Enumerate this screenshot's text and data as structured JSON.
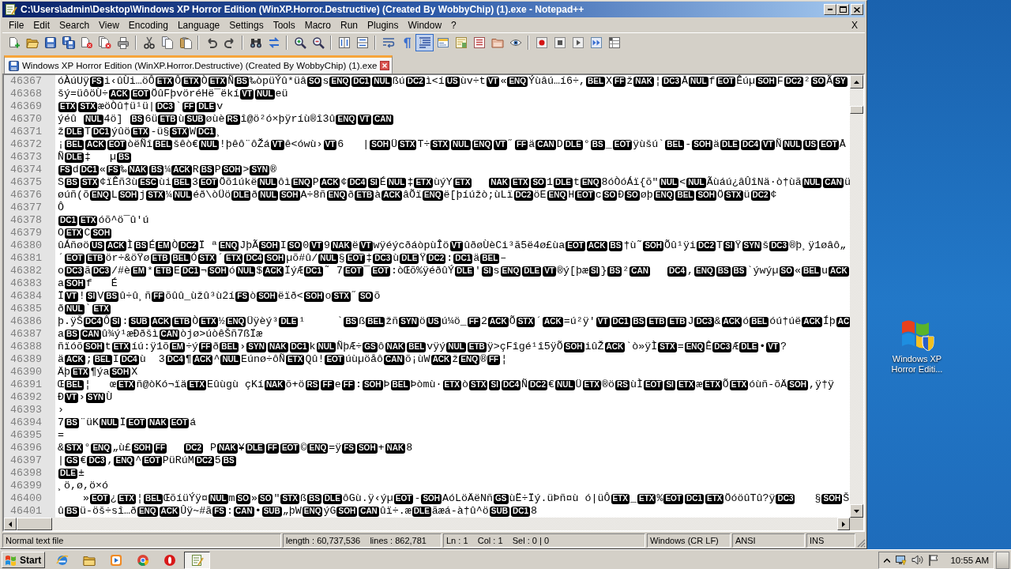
{
  "window": {
    "title": "C:\\Users\\admin\\Desktop\\Windows XP Horror Edition (WinXP.Horror.Destructive) (Created By WobbyChip) (1).exe - Notepad++"
  },
  "menu": {
    "items": [
      "File",
      "Edit",
      "Search",
      "View",
      "Encoding",
      "Language",
      "Settings",
      "Tools",
      "Macro",
      "Run",
      "Plugins",
      "Window",
      "?"
    ],
    "close": "X"
  },
  "toolbar": [
    {
      "buttons": [
        {
          "kind": "new",
          "pressed": false
        },
        {
          "kind": "open",
          "pressed": false
        },
        {
          "kind": "save",
          "pressed": false
        },
        {
          "kind": "save_all",
          "pressed": false
        },
        {
          "kind": "close",
          "pressed": false
        },
        {
          "kind": "close_all",
          "pressed": false
        },
        {
          "kind": "print",
          "pressed": false
        }
      ]
    },
    {
      "buttons": [
        {
          "kind": "cut",
          "pressed": false
        },
        {
          "kind": "copy",
          "pressed": false
        },
        {
          "kind": "paste",
          "pressed": false
        }
      ]
    },
    {
      "buttons": [
        {
          "kind": "undo",
          "pressed": false
        },
        {
          "kind": "redo",
          "pressed": false
        }
      ]
    },
    {
      "buttons": [
        {
          "kind": "find",
          "pressed": false
        },
        {
          "kind": "replace",
          "pressed": false
        }
      ]
    },
    {
      "buttons": [
        {
          "kind": "zoom_in",
          "pressed": false
        },
        {
          "kind": "zoom_out",
          "pressed": false
        }
      ]
    },
    {
      "buttons": [
        {
          "kind": "sync_vertical",
          "pressed": false
        },
        {
          "kind": "sync_horizontal",
          "pressed": false
        }
      ]
    },
    {
      "buttons": [
        {
          "kind": "word_wrap",
          "pressed": false
        },
        {
          "kind": "show_all",
          "pressed": false
        },
        {
          "kind": "indent_guide",
          "pressed": true
        },
        {
          "kind": "language",
          "pressed": false
        },
        {
          "kind": "doc_map",
          "pressed": false
        },
        {
          "kind": "function_list",
          "pressed": false
        },
        {
          "kind": "folder_workspace",
          "pressed": false
        },
        {
          "kind": "monitoring",
          "pressed": false
        }
      ]
    },
    {
      "buttons": [
        {
          "kind": "record",
          "pressed": false
        },
        {
          "kind": "stop",
          "pressed": false
        },
        {
          "kind": "play",
          "pressed": false
        },
        {
          "kind": "play_multiple",
          "pressed": false
        },
        {
          "kind": "save_macro",
          "pressed": false
        }
      ]
    }
  ],
  "tabs": [
    {
      "label": "Windows XP Horror Edition (WinXP.Horror.Destructive) (Created By WobbyChip) (1).exe",
      "selected": true
    }
  ],
  "editor": {
    "lines": [
      {
        "number": "46367",
        "runs": [
          {
            "text": "óÀúUÿ",
            "control": "FS"
          },
          {
            "text": "i‹ûÙi…öÔ",
            "control": "ETX"
          },
          {
            "text": "Ô",
            "control": "ETX"
          },
          {
            "text": "Ò",
            "control": "ETX"
          },
          {
            "text": "Ñ",
            "control": "BS"
          },
          {
            "text": "‰òpüÝû*üâ",
            "control": "SO"
          },
          {
            "text": "s",
            "control": "ENQ"
          },
          {
            "control": "DC1"
          },
          {
            "control": "NUL"
          },
          {
            "text": "ßú",
            "control": "DC2"
          },
          {
            "text": "ì<í",
            "control": "US"
          },
          {
            "text": "ùv÷t",
            "control": "VT"
          },
          {
            "text": "«",
            "control": "ENQ"
          },
          {
            "text": "Ýùâú…í6÷,",
            "control": "BEL"
          },
          {
            "text": "X",
            "control": "FF"
          },
          {
            "text": "ž",
            "control": "NAK"
          },
          {
            "text": "¦",
            "control": "DC3"
          },
          {
            "text": "Å",
            "control": "NUL"
          },
          {
            "text": "f",
            "control": "EOT"
          },
          {
            "text": "Êúµ",
            "control": "SOH"
          },
          {
            "text": "F",
            "control": "DC2"
          },
          {
            "text": "²",
            "control": "SO"
          },
          {
            "text": "Ã",
            "control": "SY"
          }
        ]
      },
      {
        "number": "46368",
        "runs": [
          {
            "text": "šý=üôöÙ÷",
            "control": "ACK"
          },
          {
            "control": "EOT"
          },
          {
            "text": "ÖûFþvöréHë¯ëkí",
            "control": "VT"
          },
          {
            "control": "NUL"
          },
          {
            "text": "eü"
          }
        ]
      },
      {
        "number": "46369",
        "runs": [
          {
            "control": "ETX"
          },
          {
            "control": "STX"
          },
          {
            "text": "æöÒû†ü¹ü|",
            "control": "DC3"
          },
          {
            "text": "`",
            "control": "FF"
          },
          {
            "control": "DLE"
          },
          {
            "text": "v"
          }
        ]
      },
      {
        "number": "46370",
        "runs": [
          {
            "text": "ýéû ",
            "control": "NUL"
          },
          {
            "text": "4ö] ",
            "control": "BS"
          },
          {
            "text": "6ü",
            "control": "ETB"
          },
          {
            "text": "ù",
            "control": "SUB"
          },
          {
            "text": "øùè",
            "control": "RS"
          },
          {
            "text": "î@ö²ó×þÿríù®î3û",
            "control": "ENQ"
          },
          {
            "control": "VT"
          },
          {
            "control": "CAN"
          }
        ]
      },
      {
        "number": "46371",
        "runs": [
          {
            "text": "ž",
            "control": "DLE"
          },
          {
            "text": "T",
            "control": "DC1"
          },
          {
            "text": "ýûö",
            "control": "ETX"
          },
          {
            "text": "-ü§",
            "control": "STX"
          },
          {
            "text": "W",
            "control": "DC1"
          },
          {
            "text": "¸"
          }
        ]
      },
      {
        "number": "46372",
        "runs": [
          {
            "text": "¡",
            "control": "BEL"
          },
          {
            "control": "ACK"
          },
          {
            "control": "EOT"
          },
          {
            "text": "òëÑî",
            "control": "BEL"
          },
          {
            "text": "šêò€",
            "control": "NUL"
          },
          {
            "text": "!þêô¨ôŽá",
            "control": "VT"
          },
          {
            "text": "ê<ówù›",
            "control": "VT"
          },
          {
            "text": "6   |",
            "control": "SOH"
          },
          {
            "text": "Ü",
            "control": "STX"
          },
          {
            "text": "T÷",
            "control": "STX"
          },
          {
            "control": "NUL"
          },
          {
            "control": "ENQ"
          },
          {
            "control": "VT"
          },
          {
            "text": "˝",
            "control": "FF"
          },
          {
            "text": "ä",
            "control": "CAN"
          },
          {
            "text": "D",
            "control": "DLE"
          },
          {
            "text": "°",
            "control": "BS"
          },
          {
            "text": "_",
            "control": "EOT"
          },
          {
            "text": "ÿùšú`",
            "control": "BEL"
          },
          {
            "text": "-",
            "control": "SOH"
          },
          {
            "text": "ä",
            "control": "DLE"
          },
          {
            "control": "DC4"
          },
          {
            "control": "VT"
          },
          {
            "text": "Ñ",
            "control": "NUL"
          },
          {
            "control": "US"
          },
          {
            "control": "EOT"
          },
          {
            "text": "Å"
          }
        ]
      },
      {
        "number": "46373",
        "runs": [
          {
            "text": "Ñ",
            "control": "DLE"
          },
          {
            "text": "‡   µ",
            "control": "BS"
          }
        ]
      },
      {
        "number": "46374",
        "runs": [
          {
            "control": "FS"
          },
          {
            "text": "d",
            "control": "DC1"
          },
          {
            "text": "«",
            "control": "FS"
          },
          {
            "text": "‰",
            "control": "NAK"
          },
          {
            "control": "BS"
          },
          {
            "text": "¼",
            "control": "ACK"
          },
          {
            "text": "R",
            "control": "BS"
          },
          {
            "text": "P",
            "control": "SOH"
          },
          {
            "text": ">",
            "control": "SYN"
          },
          {
            "text": "®"
          }
        ]
      },
      {
        "number": "46375",
        "runs": [
          {
            "text": "S",
            "control": "BS"
          },
          {
            "control": "STX"
          },
          {
            "text": "¢ïÊñ3ù",
            "control": "ESC"
          },
          {
            "text": "ùi",
            "control": "BEL"
          },
          {
            "text": "3",
            "control": "EOT"
          },
          {
            "text": "Öõ1úkë",
            "control": "NUL"
          },
          {
            "text": "ôì",
            "control": "ENQ"
          },
          {
            "text": "P",
            "control": "ACK"
          },
          {
            "text": "¢",
            "control": "DC4"
          },
          {
            "control": "SI"
          },
          {
            "text": "É",
            "control": "NUL"
          },
          {
            "text": "‡",
            "control": "ETX"
          },
          {
            "text": "ùýY",
            "control": "ETX"
          },
          {
            "gap": true,
            "control": "NAK"
          },
          {
            "control": "ETX"
          },
          {
            "control": "SO"
          },
          {
            "text": "1",
            "control": "DLE"
          },
          {
            "text": "t",
            "control": "ENQ"
          },
          {
            "text": "8óÒóÁï{õ\"",
            "control": "NUL"
          },
          {
            "text": "<",
            "control": "NUL"
          },
          {
            "text": "Ãùáú¿âÛîNä·ò†ùã",
            "control": "NUL"
          },
          {
            "control": "CAN"
          },
          {
            "text": "ü"
          }
        ]
      },
      {
        "number": "46376",
        "runs": [
          {
            "text": "øúñ(õ",
            "control": "ENQ"
          },
          {
            "text": "L",
            "control": "SOH"
          },
          {
            "text": "j",
            "control": "STX"
          },
          {
            "text": "¼",
            "control": "NUL"
          },
          {
            "text": "éð\\òÜö",
            "control": "DLE"
          },
          {
            "text": "ð",
            "control": "NUL"
          },
          {
            "control": "SOH"
          },
          {
            "text": "A÷8ñ",
            "control": "ENQ"
          },
          {
            "text": "ð",
            "control": "ETB"
          },
          {
            "text": "à",
            "control": "ACK"
          },
          {
            "text": "âÕï",
            "control": "ENQ"
          },
          {
            "text": "ë[þíúžò;ùLï",
            "control": "DC2"
          },
          {
            "text": "öE",
            "control": "ENQ"
          },
          {
            "text": "H",
            "control": "EOT"
          },
          {
            "text": "c",
            "control": "SO"
          },
          {
            "text": "Ð",
            "control": "SO"
          },
          {
            "text": "øþ",
            "control": "ENQ"
          },
          {
            "control": "BEL"
          },
          {
            "control": "SOH"
          },
          {
            "text": "Ö",
            "control": "STX"
          },
          {
            "text": "ü",
            "control": "DC2"
          },
          {
            "text": "¢"
          }
        ]
      },
      {
        "number": "46377",
        "runs": [
          {
            "text": "Ô"
          }
        ]
      },
      {
        "number": "46378",
        "runs": [
          {
            "control": "DC1"
          },
          {
            "control": "ETX"
          },
          {
            "text": "óõ^ö¯û'ú"
          }
        ]
      },
      {
        "number": "46379",
        "runs": [
          {
            "text": "O",
            "control": "ETX"
          },
          {
            "text": "C",
            "control": "SOH"
          }
        ]
      },
      {
        "number": "46380",
        "runs": [
          {
            "text": "ûÁñøö",
            "control": "US"
          },
          {
            "control": "ACK"
          },
          {
            "text": "Ì",
            "control": "BS"
          },
          {
            "text": "É",
            "control": "EM"
          },
          {
            "text": "Ò",
            "control": "DC2"
          },
          {
            "text": "Ï ª",
            "control": "ENQ"
          },
          {
            "text": "JþÃ",
            "control": "SOH"
          },
          {
            "text": "I",
            "control": "SO"
          },
          {
            "text": "0",
            "control": "VT"
          },
          {
            "text": "9",
            "control": "NAK"
          },
          {
            "text": "ë",
            "control": "VT"
          },
          {
            "text": "wÿéýcðáòpùÎö",
            "control": "VT"
          },
          {
            "text": "ûðøÙèCi³ã5ë4ø£ùa",
            "control": "EOT"
          },
          {
            "control": "ACK"
          },
          {
            "control": "BS"
          },
          {
            "text": "†ù˜",
            "control": "SOH"
          },
          {
            "text": "Õû¹ÿi",
            "control": "DC2"
          },
          {
            "text": "T",
            "control": "SI"
          },
          {
            "text": "Ÿ",
            "control": "SYN"
          },
          {
            "text": "š",
            "control": "DC3"
          },
          {
            "text": "®þ¸ÿ1øâô„"
          }
        ]
      },
      {
        "number": "46381",
        "runs": [
          {
            "text": "´",
            "control": "EOT"
          },
          {
            "control": "ETB"
          },
          {
            "text": "ör÷&öŸø",
            "control": "ETB"
          },
          {
            "control": "BEL"
          },
          {
            "text": "Ó",
            "control": "STX"
          },
          {
            "text": "´",
            "control": "ETX"
          },
          {
            "control": "DC4"
          },
          {
            "control": "SOH"
          },
          {
            "text": "µõ#û/",
            "control": "NUL"
          },
          {
            "text": "§",
            "control": "EOT"
          },
          {
            "text": "‡",
            "control": "DC3"
          },
          {
            "text": "ù",
            "control": "DLE"
          },
          {
            "text": "Ÿ",
            "control": "DC2"
          },
          {
            "text": ":",
            "control": "DC1"
          },
          {
            "text": "ä",
            "control": "BEL"
          },
          {
            "text": "–"
          }
        ]
      },
      {
        "number": "46382",
        "runs": [
          {
            "text": "o",
            "control": "DC3"
          },
          {
            "text": "ã",
            "control": "DC3"
          },
          {
            "text": "/#è",
            "control": "EM"
          },
          {
            "text": "*",
            "control": "ETB"
          },
          {
            "text": "E",
            "control": "DC1"
          },
          {
            "text": "¬",
            "control": "SOH"
          },
          {
            "text": "ó",
            "control": "NUL"
          },
          {
            "text": "$",
            "control": "ACK"
          },
          {
            "text": "ÏýÆ",
            "control": "DC1"
          },
          {
            "text": "˜ 7",
            "control": "EOT"
          },
          {
            "text": "¯",
            "control": "EOT"
          },
          {
            "text": ":òŒõ%ÿéðûÝ",
            "control": "DLE"
          },
          {
            "text": "'",
            "control": "SI"
          },
          {
            "text": "s",
            "control": "ENQ"
          },
          {
            "control": "DLE"
          },
          {
            "control": "VT"
          },
          {
            "text": "®ý[þæ",
            "control": "SI"
          },
          {
            "text": "}",
            "control": "BS"
          },
          {
            "text": "²",
            "control": "CAN"
          },
          {
            "gap": true,
            "control": "DC4"
          },
          {
            "text": ",",
            "control": "ENQ"
          },
          {
            "control": "BS"
          },
          {
            "control": "BS"
          },
          {
            "text": "`ýwýµ",
            "control": "SO"
          },
          {
            "text": "«",
            "control": "BEL"
          },
          {
            "text": "u",
            "control": "ACK"
          }
        ]
      },
      {
        "number": "46383",
        "runs": [
          {
            "text": "a",
            "control": "SOH"
          },
          {
            "text": "f   É"
          }
        ]
      },
      {
        "number": "46384",
        "runs": [
          {
            "text": "Ï",
            "control": "VT"
          },
          {
            "text": "!",
            "control": "SI"
          },
          {
            "text": "V",
            "control": "BS"
          },
          {
            "text": "û÷û¸ñ",
            "control": "FF"
          },
          {
            "text": "õûû_ùžû³ù2í",
            "control": "FS"
          },
          {
            "text": "ò",
            "control": "SOH"
          },
          {
            "text": "ëïð<",
            "control": "SOH"
          },
          {
            "text": "o",
            "control": "STX"
          },
          {
            "text": "˝",
            "control": "SO"
          },
          {
            "text": "õ"
          }
        ]
      },
      {
        "number": "46385",
        "runs": [
          {
            "text": "ð",
            "control": "NUL"
          },
          {
            "text": "`",
            "control": "ETX"
          }
        ]
      },
      {
        "number": "46386",
        "runs": [
          {
            "text": "þ.ÿŠ",
            "control": "DC4"
          },
          {
            "text": "Ô",
            "control": "SI"
          },
          {
            "text": ":",
            "control": "SUB"
          },
          {
            "control": "ACK"
          },
          {
            "control": "ETB"
          },
          {
            "text": "Ò",
            "control": "ETX"
          },
          {
            "text": "½",
            "control": "ENQ"
          },
          {
            "text": "Üÿèý³",
            "control": "DLE"
          },
          {
            "text": "¹     `",
            "control": "BS"
          },
          {
            "text": "ß",
            "control": "BEL"
          },
          {
            "text": "žñ",
            "control": "SYN"
          },
          {
            "text": "ö",
            "control": "US"
          },
          {
            "text": "ú¼ö_",
            "control": "FF"
          },
          {
            "text": "2",
            "control": "ACK"
          },
          {
            "text": "Õ",
            "control": "STX"
          },
          {
            "text": "´",
            "control": "ACK"
          },
          {
            "text": "=ú²ÿ'",
            "control": "VT"
          },
          {
            "control": "DC1"
          },
          {
            "control": "BS"
          },
          {
            "control": "ETB"
          },
          {
            "control": "ETB"
          },
          {
            "text": "J",
            "control": "DC3"
          },
          {
            "text": "&",
            "control": "ACK"
          },
          {
            "text": "ó",
            "control": "BEL"
          },
          {
            "text": "óú†úë",
            "control": "ACK"
          },
          {
            "text": "Íþ",
            "control": "AC"
          }
        ]
      },
      {
        "number": "46387",
        "runs": [
          {
            "text": "a",
            "control": "BS"
          },
          {
            "control": "CAN"
          },
          {
            "text": "û¾ý¹æÐðšì",
            "control": "CAN"
          },
          {
            "text": "òjø>úòêŠñ7ßÏæ"
          }
        ]
      },
      {
        "number": "46388",
        "runs": [
          {
            "text": "ñïóõ",
            "control": "SOH"
          },
          {
            "text": "t",
            "control": "ETX"
          },
          {
            "text": "íú:ÿ1õ",
            "control": "EM"
          },
          {
            "text": "÷ý",
            "control": "FF"
          },
          {
            "text": "ð",
            "control": "BEL"
          },
          {
            "text": "›",
            "control": "SYN"
          },
          {
            "control": "NAK"
          },
          {
            "control": "DC1"
          },
          {
            "text": "k",
            "control": "NUL"
          },
          {
            "text": "ÑþÆ÷",
            "control": "GS"
          },
          {
            "text": "ô",
            "control": "NAK"
          },
          {
            "control": "BEL"
          },
          {
            "text": "vÿý",
            "control": "NUL"
          },
          {
            "control": "ETB"
          },
          {
            "text": "ÿ>çFîgé¹î5ÿÕ",
            "control": "SOH"
          },
          {
            "text": "iûŽ",
            "control": "ACK"
          },
          {
            "text": "`ò»ÿÌ",
            "control": "STX"
          },
          {
            "text": "=",
            "control": "ENQ"
          },
          {
            "text": "Ê",
            "control": "DC3"
          },
          {
            "text": "Æ",
            "control": "DLE"
          },
          {
            "text": "•",
            "control": "VT"
          },
          {
            "text": "?"
          }
        ]
      },
      {
        "number": "46389",
        "runs": [
          {
            "text": "ä",
            "control": "ACK"
          },
          {
            "text": ";",
            "control": "BEL"
          },
          {
            "text": "I",
            "control": "DC4"
          },
          {
            "text": "ù  3",
            "control": "DC4"
          },
          {
            "text": "¶",
            "control": "ACK"
          },
          {
            "text": "^",
            "control": "NUL"
          },
          {
            "text": "Eúnø÷ôÑ",
            "control": "ETX"
          },
          {
            "text": "Qû!",
            "control": "EOT"
          },
          {
            "text": "úùµöåô",
            "control": "CAN"
          },
          {
            "text": "õ¡ùW",
            "control": "ACK"
          },
          {
            "text": "ž",
            "control": "ENQ"
          },
          {
            "text": "®",
            "control": "FF"
          },
          {
            "text": "¦"
          }
        ]
      },
      {
        "number": "46390",
        "runs": [
          {
            "text": "Äþ",
            "control": "ETX"
          },
          {
            "text": "¶ýa",
            "control": "SOH"
          },
          {
            "text": "X"
          }
        ]
      },
      {
        "number": "46391",
        "runs": [
          {
            "text": "Œ",
            "control": "BEL"
          },
          {
            "text": "¦   œ",
            "control": "ETX"
          },
          {
            "text": "ñ@òKó¬ïä",
            "control": "ETX"
          },
          {
            "text": "Eûùgù çKí",
            "control": "NAK"
          },
          {
            "text": "õ+ö",
            "control": "RS"
          },
          {
            "control": "FF"
          },
          {
            "text": "e",
            "control": "FF"
          },
          {
            "text": ":",
            "control": "SOH"
          },
          {
            "text": "Þ",
            "control": "BEL"
          },
          {
            "text": "Þòmù·",
            "control": "ETX"
          },
          {
            "text": "ò",
            "control": "STX"
          },
          {
            "control": "SI"
          },
          {
            "control": "DC4"
          },
          {
            "text": "Ñ",
            "control": "DC2"
          },
          {
            "text": "€",
            "control": "NUL"
          },
          {
            "text": "Ü",
            "control": "ETX"
          },
          {
            "text": "®ö",
            "control": "RS"
          },
          {
            "text": "ùÌ",
            "control": "EOT"
          },
          {
            "control": "SI"
          },
          {
            "control": "ETX"
          },
          {
            "text": "æ",
            "control": "ETX"
          },
          {
            "text": "Õ",
            "control": "ETX"
          },
          {
            "text": "óùñ-õÄ",
            "control": "SOH"
          },
          {
            "text": ",ÿ†ÿ"
          }
        ]
      },
      {
        "number": "46392",
        "runs": [
          {
            "text": "Ð",
            "control": "VT"
          },
          {
            "text": "›",
            "control": "SYN"
          },
          {
            "text": "Ù"
          }
        ]
      },
      {
        "number": "46393",
        "runs": [
          {
            "text": "›"
          }
        ]
      },
      {
        "number": "46394",
        "runs": [
          {
            "text": "7",
            "control": "BS"
          },
          {
            "text": "¨üK",
            "control": "NUL"
          },
          {
            "text": "Ï",
            "control": "EOT"
          },
          {
            "control": "NAK"
          },
          {
            "control": "EOT"
          },
          {
            "text": "á"
          }
        ]
      },
      {
        "number": "46395",
        "runs": [
          {
            "text": "="
          }
        ]
      },
      {
        "number": "46396",
        "runs": [
          {
            "text": "&",
            "control": "STX"
          },
          {
            "text": "°",
            "control": "ENQ"
          },
          {
            "text": "„ù£",
            "control": "SOH"
          },
          {
            "control": "FF"
          },
          {
            "gap": true,
            "control": "DC2"
          },
          {
            "text": " P",
            "control": "NAK"
          },
          {
            "text": "¥",
            "control": "DLE"
          },
          {
            "control": "FF"
          },
          {
            "control": "EOT"
          },
          {
            "text": "©",
            "control": "ENQ"
          },
          {
            "text": "=ÿ",
            "control": "FS"
          },
          {
            "control": "SOH"
          },
          {
            "text": "+",
            "control": "NAK"
          },
          {
            "text": "8"
          }
        ]
      },
      {
        "number": "46397",
        "runs": [
          {
            "text": "|",
            "control": "GS"
          },
          {
            "text": "€",
            "control": "DC3"
          },
          {
            "text": ",",
            "control": "ENQ"
          },
          {
            "text": "^",
            "control": "EOT"
          },
          {
            "text": "PüRúM",
            "control": "DC2"
          },
          {
            "text": "5",
            "control": "BS"
          }
        ]
      },
      {
        "number": "46398",
        "runs": [
          {
            "control": "DLE"
          },
          {
            "text": "±"
          }
        ]
      },
      {
        "number": "46399",
        "runs": [
          {
            "text": "¸ö,ø,ö×ó"
          }
        ]
      },
      {
        "number": "46400",
        "runs": [
          {
            "text": "    »",
            "control": "EOT"
          },
          {
            "text": "¿",
            "control": "ETX"
          },
          {
            "text": "¦",
            "control": "BEL"
          },
          {
            "text": "ŒõíüÝÿ¤",
            "control": "NUL"
          },
          {
            "text": "m",
            "control": "SO"
          },
          {
            "text": "»",
            "control": "SO"
          },
          {
            "text": "\"",
            "control": "STX"
          },
          {
            "text": "ß",
            "control": "BS"
          },
          {
            "control": "DLE"
          },
          {
            "text": "ôGù.ÿ‹ýµ",
            "control": "EOT"
          },
          {
            "text": "-",
            "control": "SOH"
          },
          {
            "text": "AóLöÄëNñ",
            "control": "GS"
          },
          {
            "text": "ùË÷Ïý.üÞñ¤ù ó|üÔ",
            "control": "ETX"
          },
          {
            "text": "_",
            "control": "ETX"
          },
          {
            "text": "%",
            "control": "EOT"
          },
          {
            "control": "DC1"
          },
          {
            "control": "ETX"
          },
          {
            "text": "ÖóöûTû?ÿ",
            "control": "DC3"
          },
          {
            "text": "   §",
            "control": "SOH"
          },
          {
            "text": "Š"
          }
        ]
      },
      {
        "number": "46401",
        "runs": [
          {
            "text": "û",
            "control": "BS"
          },
          {
            "text": "ü-öš÷sî…ð",
            "control": "ENQ"
          },
          {
            "control": "ACK"
          },
          {
            "text": "Ûÿ~#ã",
            "control": "FS"
          },
          {
            "text": ":",
            "control": "CAN"
          },
          {
            "text": "•",
            "control": "SUB"
          },
          {
            "text": "„þW",
            "control": "ENQ"
          },
          {
            "text": "ýG",
            "control": "SOH"
          },
          {
            "control": "CAN"
          },
          {
            "text": "ûï÷.æ",
            "control": "DLE"
          },
          {
            "text": "ãæá-à†û^ö",
            "control": "SUB"
          },
          {
            "control": "DC1"
          },
          {
            "text": "8"
          }
        ]
      }
    ]
  },
  "status_bar": {
    "file_type": "Normal text file",
    "size": "length : 60,737,536    lines : 862,781",
    "position": "Ln : 1    Col : 1    Sel : 0 | 0",
    "line_endings": "Windows (CR LF)",
    "encoding": "ANSI",
    "mode": "INS"
  },
  "desktop": {
    "icons": [
      {
        "label": "Windows XP Horror Editi..."
      }
    ]
  },
  "taskbar": {
    "start": "Start",
    "quick_launch": [
      {
        "kind": "globe"
      },
      {
        "kind": "folder"
      },
      {
        "kind": "media"
      },
      {
        "kind": "browser"
      },
      {
        "kind": "ring"
      }
    ],
    "tasks": [
      {
        "kind": "notepad",
        "selected": true
      }
    ],
    "clock": "10:55 AM"
  }
}
